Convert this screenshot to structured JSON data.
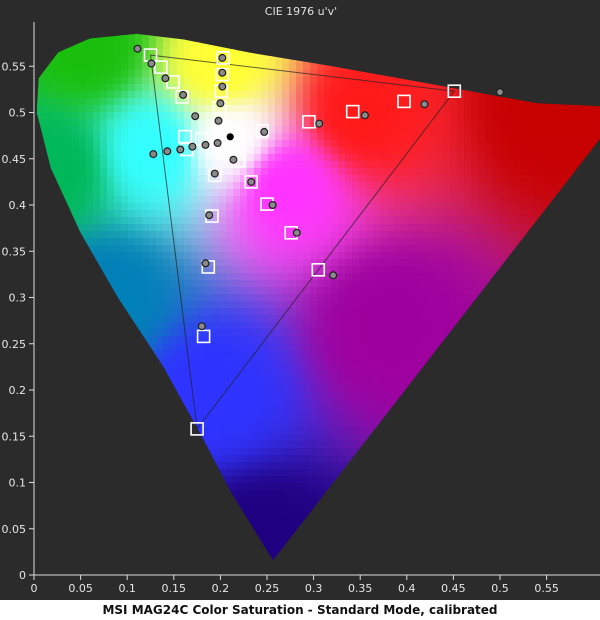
{
  "chart_data": {
    "type": "scatter",
    "title": "CIE 1976 u'v'",
    "caption": "MSI MAG24C Color Saturation - Standard Mode, calibrated",
    "xlim": [
      0,
      0.6
    ],
    "ylim": [
      0,
      0.6
    ],
    "x_ticks": [
      "0",
      "0.05",
      "0.1",
      "0.15",
      "0.2",
      "0.25",
      "0.3",
      "0.35",
      "0.4",
      "0.45",
      "0.5",
      "0.55"
    ],
    "y_ticks": [
      "0",
      "0.05",
      "0.1",
      "0.15",
      "0.2",
      "0.25",
      "0.3",
      "0.35",
      "0.4",
      "0.45",
      "0.5",
      "0.55"
    ],
    "grid": false,
    "white_point": {
      "u": 0.2105,
      "v": 0.4737
    },
    "gamut_triangle": [
      {
        "u": 0.451,
        "v": 0.523
      },
      {
        "u": 0.125,
        "v": 0.562
      },
      {
        "u": 0.175,
        "v": 0.158
      }
    ],
    "series": [
      {
        "marker": "square",
        "points": [
          {
            "u": 0.197,
            "v": 0.469
          },
          {
            "u": 0.245,
            "v": 0.48
          },
          {
            "u": 0.295,
            "v": 0.49
          },
          {
            "u": 0.342,
            "v": 0.501
          },
          {
            "u": 0.397,
            "v": 0.512
          },
          {
            "u": 0.451,
            "v": 0.523
          },
          {
            "u": 0.198,
            "v": 0.487
          },
          {
            "u": 0.199,
            "v": 0.505
          },
          {
            "u": 0.201,
            "v": 0.523
          },
          {
            "u": 0.202,
            "v": 0.541
          },
          {
            "u": 0.203,
            "v": 0.559
          },
          {
            "u": 0.18,
            "v": 0.471
          },
          {
            "u": 0.162,
            "v": 0.474
          },
          {
            "u": 0.159,
            "v": 0.517
          },
          {
            "u": 0.149,
            "v": 0.533
          },
          {
            "u": 0.136,
            "v": 0.549
          },
          {
            "u": 0.125,
            "v": 0.562
          },
          {
            "u": 0.164,
            "v": 0.46
          },
          {
            "u": 0.219,
            "v": 0.448
          },
          {
            "u": 0.233,
            "v": 0.425
          },
          {
            "u": 0.25,
            "v": 0.401
          },
          {
            "u": 0.276,
            "v": 0.37
          },
          {
            "u": 0.305,
            "v": 0.33
          },
          {
            "u": 0.194,
            "v": 0.432
          },
          {
            "u": 0.191,
            "v": 0.388
          },
          {
            "u": 0.187,
            "v": 0.333
          },
          {
            "u": 0.182,
            "v": 0.258
          },
          {
            "u": 0.175,
            "v": 0.158
          }
        ]
      },
      {
        "marker": "circle",
        "points": [
          {
            "u": 0.247,
            "v": 0.479
          },
          {
            "u": 0.306,
            "v": 0.488
          },
          {
            "u": 0.355,
            "v": 0.497
          },
          {
            "u": 0.419,
            "v": 0.509
          },
          {
            "u": 0.5,
            "v": 0.522
          },
          {
            "u": 0.198,
            "v": 0.491
          },
          {
            "u": 0.2,
            "v": 0.51
          },
          {
            "u": 0.202,
            "v": 0.528
          },
          {
            "u": 0.202,
            "v": 0.543
          },
          {
            "u": 0.202,
            "v": 0.559
          },
          {
            "u": 0.173,
            "v": 0.496
          },
          {
            "u": 0.16,
            "v": 0.519
          },
          {
            "u": 0.141,
            "v": 0.537
          },
          {
            "u": 0.126,
            "v": 0.553
          },
          {
            "u": 0.111,
            "v": 0.569
          },
          {
            "u": 0.197,
            "v": 0.467
          },
          {
            "u": 0.184,
            "v": 0.465
          },
          {
            "u": 0.17,
            "v": 0.463
          },
          {
            "u": 0.157,
            "v": 0.46
          },
          {
            "u": 0.143,
            "v": 0.458
          },
          {
            "u": 0.128,
            "v": 0.455
          },
          {
            "u": 0.214,
            "v": 0.449
          },
          {
            "u": 0.233,
            "v": 0.425
          },
          {
            "u": 0.256,
            "v": 0.4
          },
          {
            "u": 0.282,
            "v": 0.37
          },
          {
            "u": 0.321,
            "v": 0.324
          },
          {
            "u": 0.194,
            "v": 0.434
          },
          {
            "u": 0.188,
            "v": 0.389
          },
          {
            "u": 0.184,
            "v": 0.337
          },
          {
            "u": 0.18,
            "v": 0.269
          }
        ]
      }
    ]
  }
}
